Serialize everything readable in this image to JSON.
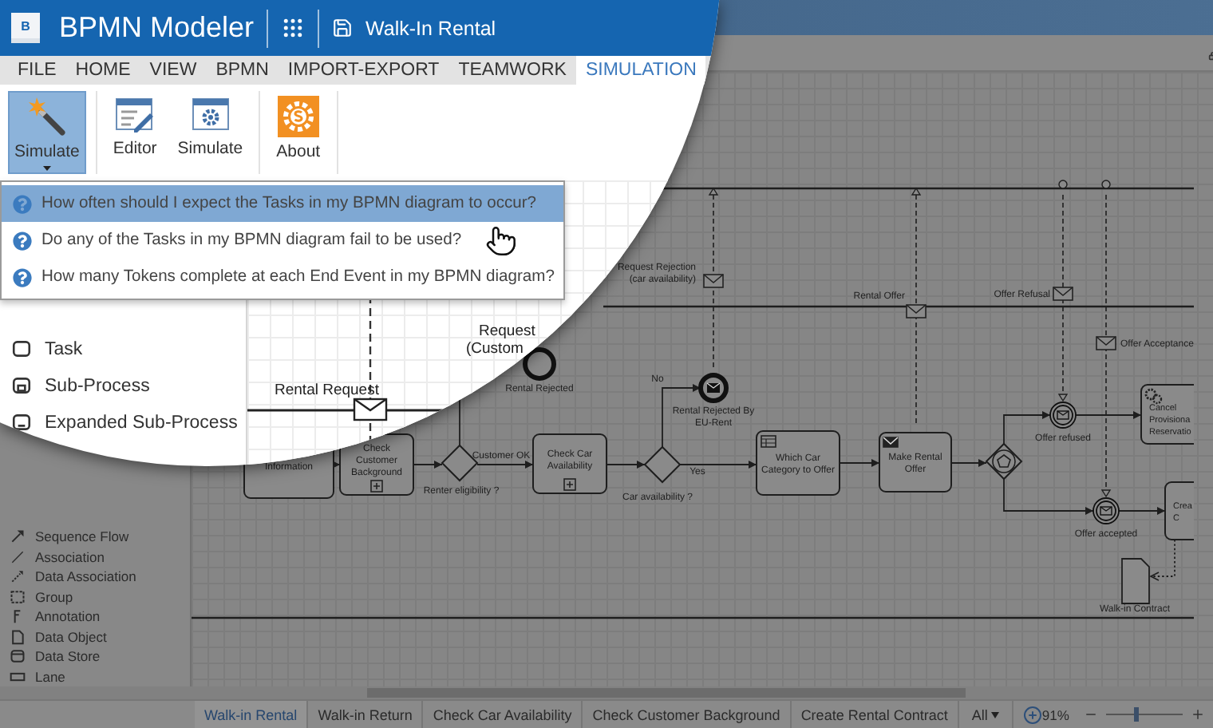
{
  "app": {
    "logo_letter": "B",
    "title": "BPMN Modeler",
    "document": "Walk-In Rental"
  },
  "menu": [
    {
      "label": "FILE",
      "selected": false
    },
    {
      "label": "HOME",
      "selected": false
    },
    {
      "label": "VIEW",
      "selected": false
    },
    {
      "label": "BPMN",
      "selected": false
    },
    {
      "label": "IMPORT-EXPORT",
      "selected": false
    },
    {
      "label": "TEAMWORK",
      "selected": false
    },
    {
      "label": "SIMULATION",
      "selected": true
    }
  ],
  "ribbon_groups": [
    {
      "buttons": [
        {
          "label": "Simulate",
          "kind": "wand",
          "selected": true
        }
      ]
    },
    {
      "buttons": [
        {
          "label": "Editor",
          "kind": "editor",
          "selected": false
        },
        {
          "label": "Simulate",
          "kind": "simulate",
          "selected": false
        }
      ]
    },
    {
      "buttons": [
        {
          "label": "About",
          "kind": "about",
          "selected": false
        }
      ]
    }
  ],
  "dropdown": [
    {
      "label": "How often should I expect the Tasks in my BPMN diagram to occur?",
      "selected": true
    },
    {
      "label": "Do any of the Tasks in my BPMN diagram fail to be used?",
      "selected": false
    },
    {
      "label": "How many Tokens complete at each End Event in my BPMN diagram?",
      "selected": false
    }
  ],
  "palette_top": [
    {
      "label": "Task",
      "kind": "task"
    },
    {
      "label": "Sub-Process",
      "kind": "subprocess"
    },
    {
      "label": "Expanded Sub-Process",
      "kind": "expanded"
    }
  ],
  "palette": [
    {
      "label": "Sequence Flow",
      "kind": "sequence"
    },
    {
      "label": "Association",
      "kind": "association"
    },
    {
      "label": "Data Association",
      "kind": "data-association"
    },
    {
      "label": "Group",
      "kind": "group"
    },
    {
      "label": "Annotation",
      "kind": "annotation"
    },
    {
      "label": "Data Object",
      "kind": "data-object"
    },
    {
      "label": "Data Store",
      "kind": "data-store"
    },
    {
      "label": "Lane",
      "kind": "lane"
    }
  ],
  "lens_diagram": {
    "message": {
      "label": "Rental Request"
    },
    "labels": [
      "Request",
      "(Custom"
    ]
  },
  "diagram": {
    "tasks": [
      {
        "lines": [
          "Information"
        ],
        "kind": "plain"
      },
      {
        "lines": [
          "Check",
          "Customer",
          "Background"
        ],
        "kind": "collapsed"
      },
      {
        "lines": [
          "Check Car",
          "Availability"
        ],
        "kind": "collapsed"
      },
      {
        "lines": [
          "Which Car",
          "Category to Offer"
        ],
        "kind": "user"
      },
      {
        "lines": [
          "Make Rental",
          "Offer"
        ],
        "kind": "send"
      },
      {
        "lines": [
          "Cancel",
          "Provisiona",
          "Reservatio"
        ],
        "kind": "service"
      },
      {
        "lines": [
          "Crea",
          "C"
        ],
        "kind": "plain"
      }
    ],
    "gateways": [
      {
        "label": "Renter eligibility ?",
        "kind": "exclusive"
      },
      {
        "label": "Car availability ?",
        "kind": "exclusive"
      },
      {
        "kind": "event"
      }
    ],
    "events": [
      {
        "lines": [
          "Rental Rejected"
        ],
        "kind": "end"
      },
      {
        "lines": [
          "Rental Rejected By",
          "EU-Rent"
        ],
        "kind": "end-message"
      },
      {
        "lines": [
          "Offer refused"
        ],
        "kind": "catch-message"
      },
      {
        "lines": [
          "Offer accepted"
        ],
        "kind": "catch-message"
      }
    ],
    "messages": [
      {
        "lines": [
          "Request Rejection",
          "(car availability)"
        ]
      },
      {
        "lines": [
          "Rental Offer"
        ]
      },
      {
        "lines": [
          "Offer Refusal"
        ]
      },
      {
        "lines": [
          "Offer Acceptance"
        ]
      }
    ],
    "flow_labels": [
      "Customer OK",
      "No",
      "Yes"
    ],
    "data_objects": [
      {
        "label": "Walk-in Contract"
      }
    ]
  },
  "tabs": [
    {
      "label": "Walk-in Rental",
      "selected": true
    },
    {
      "label": "Walk-in Return",
      "selected": false
    },
    {
      "label": "Check Car Availability",
      "selected": false
    },
    {
      "label": "Check Customer Background",
      "selected": false
    },
    {
      "label": "Create Rental Contract",
      "selected": false
    }
  ],
  "tab_filter": "All",
  "zoom": {
    "reading": "91%",
    "level": 0.4
  }
}
